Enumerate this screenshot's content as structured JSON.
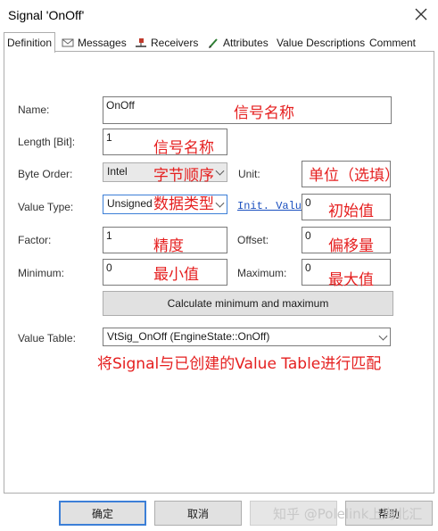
{
  "window": {
    "title": "Signal 'OnOff'"
  },
  "tabs": [
    {
      "label": "Definition",
      "icon": ""
    },
    {
      "label": "Messages",
      "icon": "envelope-icon"
    },
    {
      "label": "Receivers",
      "icon": "node-icon"
    },
    {
      "label": "Attributes",
      "icon": "pencil-icon"
    },
    {
      "label": "Value Descriptions",
      "icon": ""
    },
    {
      "label": "Comment",
      "icon": ""
    }
  ],
  "form": {
    "name_label": "Name:",
    "name_value": "OnOff",
    "length_label": "Length [Bit]:",
    "length_value": "1",
    "byte_order_label": "Byte Order:",
    "byte_order_value": "Intel",
    "unit_label": "Unit:",
    "unit_value": "",
    "value_type_label": "Value Type:",
    "value_type_value": "Unsigned",
    "init_value_link": "Init. Value",
    "init_value": "0",
    "factor_label": "Factor:",
    "factor_value": "1",
    "offset_label": "Offset:",
    "offset_value": "0",
    "minimum_label": "Minimum:",
    "minimum_value": "0",
    "maximum_label": "Maximum:",
    "maximum_value": "0",
    "calc_button": "Calculate minimum and maximum",
    "value_table_label": "Value Table:",
    "value_table_value": "VtSig_OnOff (EngineState::OnOff)"
  },
  "annotations": {
    "name": "信号名称",
    "length": "信号名称",
    "byte_order": "字节顺序",
    "unit": "单位（选填）",
    "value_type": "数据类型",
    "init_value": "初始值",
    "factor": "精度",
    "offset": "偏移量",
    "minimum": "最小值",
    "maximum": "最大值",
    "value_table": "将Signal与已创建的Value Table进行匹配"
  },
  "buttons": {
    "ok": "确定",
    "cancel": "取消",
    "apply": "",
    "help": "帮助"
  },
  "watermark": "知乎 @Polelink上海北汇",
  "colors": {
    "annotation": "#e51f1f",
    "link": "#1a4fbf",
    "default_button_border": "#3c7fd7"
  }
}
